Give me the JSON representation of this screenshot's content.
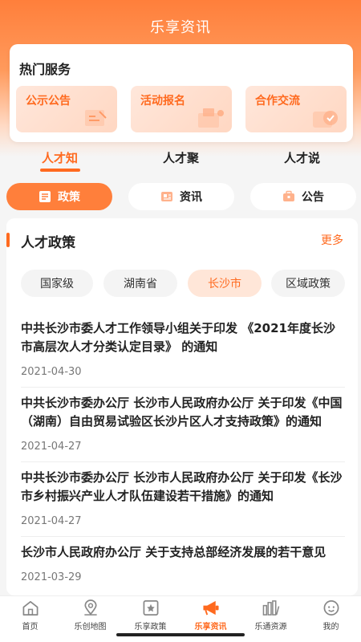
{
  "app": {
    "title": "乐享资讯"
  },
  "hot_services": {
    "title": "热门服务",
    "items": [
      {
        "label": "公示公告",
        "icon": "notice-icon"
      },
      {
        "label": "活动报名",
        "icon": "activity-icon"
      },
      {
        "label": "合作交流",
        "icon": "cooperation-icon"
      }
    ]
  },
  "tabs": [
    {
      "label": "人才知",
      "active": true
    },
    {
      "label": "人才聚",
      "active": false
    },
    {
      "label": "人才说",
      "active": false
    }
  ],
  "chips": [
    {
      "label": "政策",
      "icon": "policy-icon",
      "active": true
    },
    {
      "label": "资讯",
      "icon": "news-icon",
      "active": false
    },
    {
      "label": "公告",
      "icon": "briefcase-icon",
      "active": false
    }
  ],
  "section": {
    "title": "人才政策",
    "more": "更多"
  },
  "regions": [
    {
      "label": "国家级",
      "active": false
    },
    {
      "label": "湖南省",
      "active": false
    },
    {
      "label": "长沙市",
      "active": true
    },
    {
      "label": "区域政策",
      "active": false
    }
  ],
  "news": [
    {
      "title": "中共长沙市委人才工作领导小组关于印发 《2021年度长沙市高层次人才分类认定目录》 的通知",
      "date": "2021-04-30"
    },
    {
      "title": "中共长沙市委办公厅 长沙市人民政府办公厅 关于印发《中国（湖南）自由贸易试验区长沙片区人才支持政策》的通知",
      "date": "2021-04-27"
    },
    {
      "title": "中共长沙市委办公厅 长沙市人民政府办公厅 关于印发《长沙市乡村振兴产业人才队伍建设若干措施》的通知",
      "date": "2021-04-27"
    },
    {
      "title": "长沙市人民政府办公厅 关于支持总部经济发展的若干意见",
      "date": "2021-03-29"
    }
  ],
  "bottom_nav": [
    {
      "label": "首页",
      "icon": "home-icon",
      "active": false
    },
    {
      "label": "乐创地图",
      "icon": "map-pin-icon",
      "active": false
    },
    {
      "label": "乐享政策",
      "icon": "policy-star-icon",
      "active": false
    },
    {
      "label": "乐享资讯",
      "icon": "megaphone-icon",
      "active": true
    },
    {
      "label": "乐通资源",
      "icon": "resources-icon",
      "active": false
    },
    {
      "label": "我的",
      "icon": "profile-icon",
      "active": false
    }
  ],
  "colors": {
    "accent": "#ff6a1f",
    "accent_light": "#ffe6d8",
    "header": "#ff7f3b"
  }
}
